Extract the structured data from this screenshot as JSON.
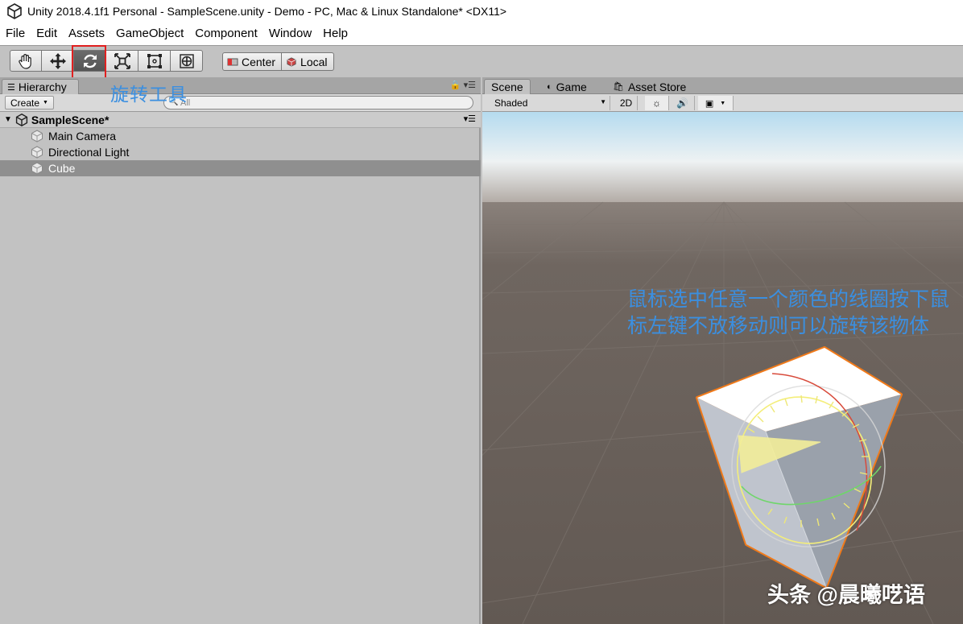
{
  "window": {
    "title": "Unity 2018.4.1f1 Personal - SampleScene.unity - Demo - PC, Mac & Linux Standalone* <DX11>"
  },
  "menu": [
    "File",
    "Edit",
    "Assets",
    "GameObject",
    "Component",
    "Window",
    "Help"
  ],
  "toolbar": {
    "tools": [
      "hand-tool",
      "move-tool",
      "rotate-tool",
      "scale-tool",
      "rect-tool",
      "transform-tool"
    ],
    "active_tool": "rotate-tool",
    "pivot_mode": "Center",
    "pivot_rotation": "Local"
  },
  "annotations": {
    "rotate_tool_label": "旋转工具",
    "drag_instruction": "鼠标选中任意一个颜色的线圈按下鼠标左键不放移动则可以旋转该物体"
  },
  "hierarchy": {
    "tab_label": "Hierarchy",
    "create_label": "Create",
    "search_placeholder": "All",
    "scene_name": "SampleScene*",
    "items": [
      {
        "label": "Main Camera",
        "selected": false
      },
      {
        "label": "Directional Light",
        "selected": false
      },
      {
        "label": "Cube",
        "selected": true
      }
    ]
  },
  "scene_view": {
    "tabs": [
      {
        "label": "Scene",
        "icon": "scene-icon",
        "active": true
      },
      {
        "label": "Game",
        "icon": "game-icon",
        "active": false
      },
      {
        "label": "Asset Store",
        "icon": "asset-store-icon",
        "active": false
      }
    ],
    "shading_mode": "Shaded",
    "mode_2d_label": "2D"
  },
  "watermark": "头条 @晨曦呓语",
  "colors": {
    "annotation_blue": "#3b8fe0",
    "highlight_red": "#e02020",
    "selection_outline": "#f07a1a",
    "ground": "#675e58",
    "sky_top": "#b5dbef"
  }
}
